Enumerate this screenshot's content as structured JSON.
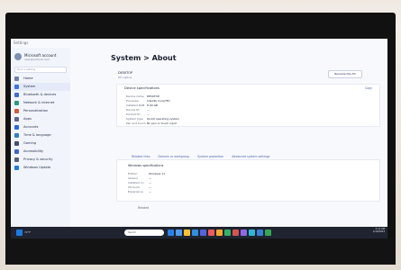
{
  "window": {
    "title": "Settings"
  },
  "profile": {
    "name": "Microsoft account",
    "email": "user@outlook.com"
  },
  "search": {
    "placeholder": "Find a setting"
  },
  "sidebar": {
    "items": [
      {
        "label": "Home",
        "color": "#6f7fa7"
      },
      {
        "label": "System",
        "color": "#3b74e0"
      },
      {
        "label": "Bluetooth & devices",
        "color": "#406ecf"
      },
      {
        "label": "Network & internet",
        "color": "#2d9c7a"
      },
      {
        "label": "Personalization",
        "color": "#d05b3e"
      },
      {
        "label": "Apps",
        "color": "#5d6788"
      },
      {
        "label": "Accounts",
        "color": "#2b6bd6"
      },
      {
        "label": "Time & language",
        "color": "#2f7fc2"
      },
      {
        "label": "Gaming",
        "color": "#4a4f62"
      },
      {
        "label": "Accessibility",
        "color": "#3c66c7"
      },
      {
        "label": "Privacy & security",
        "color": "#585f73"
      },
      {
        "label": "Windows Update",
        "color": "#1f7be0"
      }
    ]
  },
  "page": {
    "title": "System > About"
  },
  "device": {
    "name": "DESKTOP",
    "model": "HP Laptop",
    "rename_label": "Rename this PC"
  },
  "device_specs": {
    "title": "Device specifications",
    "copy_label": "Copy",
    "rows": [
      {
        "key": "Device name",
        "value": "DESKTOP"
      },
      {
        "key": "Processor",
        "value": "Intel(R) Core(TM)"
      },
      {
        "key": "Installed RAM",
        "value": "8.00 GB"
      },
      {
        "key": "Device ID",
        "value": "—"
      },
      {
        "key": "Product ID",
        "value": "—"
      },
      {
        "key": "System type",
        "value": "64-bit operating system"
      },
      {
        "key": "Pen and touch",
        "value": "No pen or touch input"
      }
    ]
  },
  "related_links": {
    "items": [
      "Related links",
      "Domain or workgroup",
      "System protection",
      "Advanced system settings"
    ]
  },
  "windows_specs": {
    "title": "Windows specifications",
    "rows": [
      {
        "key": "Edition",
        "value": "Windows 11"
      },
      {
        "key": "Version",
        "value": "—"
      },
      {
        "key": "Installed on",
        "value": "—"
      },
      {
        "key": "OS build",
        "value": "—"
      },
      {
        "key": "Experience",
        "value": "—"
      }
    ]
  },
  "related": {
    "label": "Related"
  },
  "taskbar": {
    "weather": "72°F",
    "search_label": "Search",
    "time": "2:11 PM",
    "date": "1/10/2024",
    "icons": [
      {
        "color": "#2d7fe6",
        "name": "task-view-icon"
      },
      {
        "color": "#4f9bf2",
        "name": "edge-icon"
      },
      {
        "color": "#ffbf35",
        "name": "file-explorer-icon"
      },
      {
        "color": "#2e8fe2",
        "name": "store-icon"
      },
      {
        "color": "#5664d8",
        "name": "app-icon-1"
      },
      {
        "color": "#ef5b5b",
        "name": "app-icon-2"
      },
      {
        "color": "#f4a830",
        "name": "app-icon-3"
      },
      {
        "color": "#35b26a",
        "name": "app-icon-4"
      },
      {
        "color": "#d9534f",
        "name": "app-icon-5"
      },
      {
        "color": "#8f69e8",
        "name": "app-icon-6"
      },
      {
        "color": "#2fb8d3",
        "name": "app-icon-7"
      },
      {
        "color": "#3a7ed8",
        "name": "app-icon-8"
      },
      {
        "color": "#34a853",
        "name": "app-icon-9"
      }
    ]
  }
}
